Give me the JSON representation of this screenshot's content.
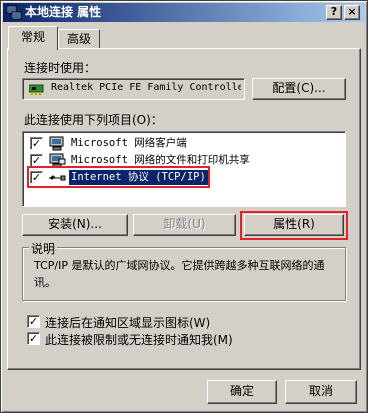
{
  "window": {
    "title": "本地连接 属性",
    "help_button": "?",
    "close_button": "×"
  },
  "tabs": [
    {
      "label": "常规",
      "active": true
    },
    {
      "label": "高级",
      "active": false
    }
  ],
  "connect_using": {
    "label": "连接时使用：",
    "adapter": "Realtek PCIe FE Family Controller",
    "configure_button": "配置(C)..."
  },
  "components": {
    "label": "此连接使用下列项目(O)：",
    "items": [
      {
        "label": "Microsoft 网络客户端",
        "checked": true,
        "icon": "network-client-icon"
      },
      {
        "label": "Microsoft 网络的文件和打印机共享",
        "checked": true,
        "icon": "file-printer-sharing-icon"
      },
      {
        "label": "Internet 协议 (TCP/IP)",
        "checked": true,
        "icon": "protocol-icon",
        "selected": true
      }
    ]
  },
  "buttons": {
    "install": "安装(N)...",
    "uninstall": "卸载(U)",
    "properties": "属性(R)"
  },
  "description": {
    "title": "说明",
    "text": "TCP/IP 是默认的广域网协议。它提供跨越多种互联网络的通讯。"
  },
  "options": [
    {
      "label": "连接后在通知区域显示图标(W)",
      "checked": true
    },
    {
      "label": "此连接被限制或无连接时通知我(M)",
      "checked": true
    }
  ],
  "footer": {
    "ok": "确定",
    "cancel": "取消"
  },
  "colors": {
    "highlight": "#e0242c",
    "selection": "#0a246a",
    "face": "#d4d0c8"
  }
}
